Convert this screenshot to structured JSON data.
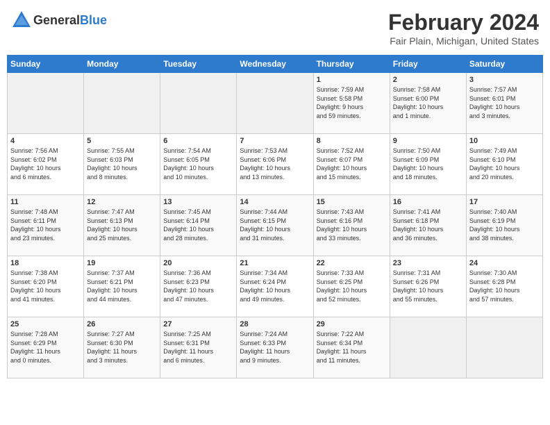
{
  "header": {
    "logo_general": "General",
    "logo_blue": "Blue",
    "month": "February 2024",
    "location": "Fair Plain, Michigan, United States"
  },
  "days_of_week": [
    "Sunday",
    "Monday",
    "Tuesday",
    "Wednesday",
    "Thursday",
    "Friday",
    "Saturday"
  ],
  "weeks": [
    [
      {
        "day": "",
        "info": ""
      },
      {
        "day": "",
        "info": ""
      },
      {
        "day": "",
        "info": ""
      },
      {
        "day": "",
        "info": ""
      },
      {
        "day": "1",
        "info": "Sunrise: 7:59 AM\nSunset: 5:58 PM\nDaylight: 9 hours\nand 59 minutes."
      },
      {
        "day": "2",
        "info": "Sunrise: 7:58 AM\nSunset: 6:00 PM\nDaylight: 10 hours\nand 1 minute."
      },
      {
        "day": "3",
        "info": "Sunrise: 7:57 AM\nSunset: 6:01 PM\nDaylight: 10 hours\nand 3 minutes."
      }
    ],
    [
      {
        "day": "4",
        "info": "Sunrise: 7:56 AM\nSunset: 6:02 PM\nDaylight: 10 hours\nand 6 minutes."
      },
      {
        "day": "5",
        "info": "Sunrise: 7:55 AM\nSunset: 6:03 PM\nDaylight: 10 hours\nand 8 minutes."
      },
      {
        "day": "6",
        "info": "Sunrise: 7:54 AM\nSunset: 6:05 PM\nDaylight: 10 hours\nand 10 minutes."
      },
      {
        "day": "7",
        "info": "Sunrise: 7:53 AM\nSunset: 6:06 PM\nDaylight: 10 hours\nand 13 minutes."
      },
      {
        "day": "8",
        "info": "Sunrise: 7:52 AM\nSunset: 6:07 PM\nDaylight: 10 hours\nand 15 minutes."
      },
      {
        "day": "9",
        "info": "Sunrise: 7:50 AM\nSunset: 6:09 PM\nDaylight: 10 hours\nand 18 minutes."
      },
      {
        "day": "10",
        "info": "Sunrise: 7:49 AM\nSunset: 6:10 PM\nDaylight: 10 hours\nand 20 minutes."
      }
    ],
    [
      {
        "day": "11",
        "info": "Sunrise: 7:48 AM\nSunset: 6:11 PM\nDaylight: 10 hours\nand 23 minutes."
      },
      {
        "day": "12",
        "info": "Sunrise: 7:47 AM\nSunset: 6:13 PM\nDaylight: 10 hours\nand 25 minutes."
      },
      {
        "day": "13",
        "info": "Sunrise: 7:45 AM\nSunset: 6:14 PM\nDaylight: 10 hours\nand 28 minutes."
      },
      {
        "day": "14",
        "info": "Sunrise: 7:44 AM\nSunset: 6:15 PM\nDaylight: 10 hours\nand 31 minutes."
      },
      {
        "day": "15",
        "info": "Sunrise: 7:43 AM\nSunset: 6:16 PM\nDaylight: 10 hours\nand 33 minutes."
      },
      {
        "day": "16",
        "info": "Sunrise: 7:41 AM\nSunset: 6:18 PM\nDaylight: 10 hours\nand 36 minutes."
      },
      {
        "day": "17",
        "info": "Sunrise: 7:40 AM\nSunset: 6:19 PM\nDaylight: 10 hours\nand 38 minutes."
      }
    ],
    [
      {
        "day": "18",
        "info": "Sunrise: 7:38 AM\nSunset: 6:20 PM\nDaylight: 10 hours\nand 41 minutes."
      },
      {
        "day": "19",
        "info": "Sunrise: 7:37 AM\nSunset: 6:21 PM\nDaylight: 10 hours\nand 44 minutes."
      },
      {
        "day": "20",
        "info": "Sunrise: 7:36 AM\nSunset: 6:23 PM\nDaylight: 10 hours\nand 47 minutes."
      },
      {
        "day": "21",
        "info": "Sunrise: 7:34 AM\nSunset: 6:24 PM\nDaylight: 10 hours\nand 49 minutes."
      },
      {
        "day": "22",
        "info": "Sunrise: 7:33 AM\nSunset: 6:25 PM\nDaylight: 10 hours\nand 52 minutes."
      },
      {
        "day": "23",
        "info": "Sunrise: 7:31 AM\nSunset: 6:26 PM\nDaylight: 10 hours\nand 55 minutes."
      },
      {
        "day": "24",
        "info": "Sunrise: 7:30 AM\nSunset: 6:28 PM\nDaylight: 10 hours\nand 57 minutes."
      }
    ],
    [
      {
        "day": "25",
        "info": "Sunrise: 7:28 AM\nSunset: 6:29 PM\nDaylight: 11 hours\nand 0 minutes."
      },
      {
        "day": "26",
        "info": "Sunrise: 7:27 AM\nSunset: 6:30 PM\nDaylight: 11 hours\nand 3 minutes."
      },
      {
        "day": "27",
        "info": "Sunrise: 7:25 AM\nSunset: 6:31 PM\nDaylight: 11 hours\nand 6 minutes."
      },
      {
        "day": "28",
        "info": "Sunrise: 7:24 AM\nSunset: 6:33 PM\nDaylight: 11 hours\nand 9 minutes."
      },
      {
        "day": "29",
        "info": "Sunrise: 7:22 AM\nSunset: 6:34 PM\nDaylight: 11 hours\nand 11 minutes."
      },
      {
        "day": "",
        "info": ""
      },
      {
        "day": "",
        "info": ""
      }
    ]
  ]
}
